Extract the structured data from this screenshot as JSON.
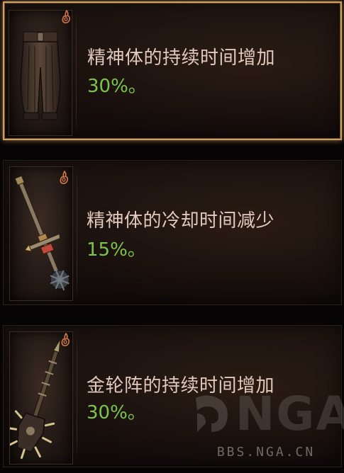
{
  "cards": [
    {
      "item": "pants",
      "selected": true,
      "description": "精神体的持续时间增加",
      "value": "30%。"
    },
    {
      "item": "mace",
      "selected": false,
      "description": "精神体的冷却时间减少",
      "value": "15%。"
    },
    {
      "item": "spiked-flail",
      "selected": false,
      "description": "金轮阵的持续时间增加",
      "value": "30%。"
    }
  ],
  "icons": {
    "rune": "flame-rune-icon",
    "accent_color": "#d6784a",
    "description_color": "#e3c9bd",
    "value_color": "#7cc44c",
    "selected_border_color": "#caa068"
  },
  "watermark": {
    "brand": "NGA",
    "url": "BBS.NGA.CN"
  }
}
